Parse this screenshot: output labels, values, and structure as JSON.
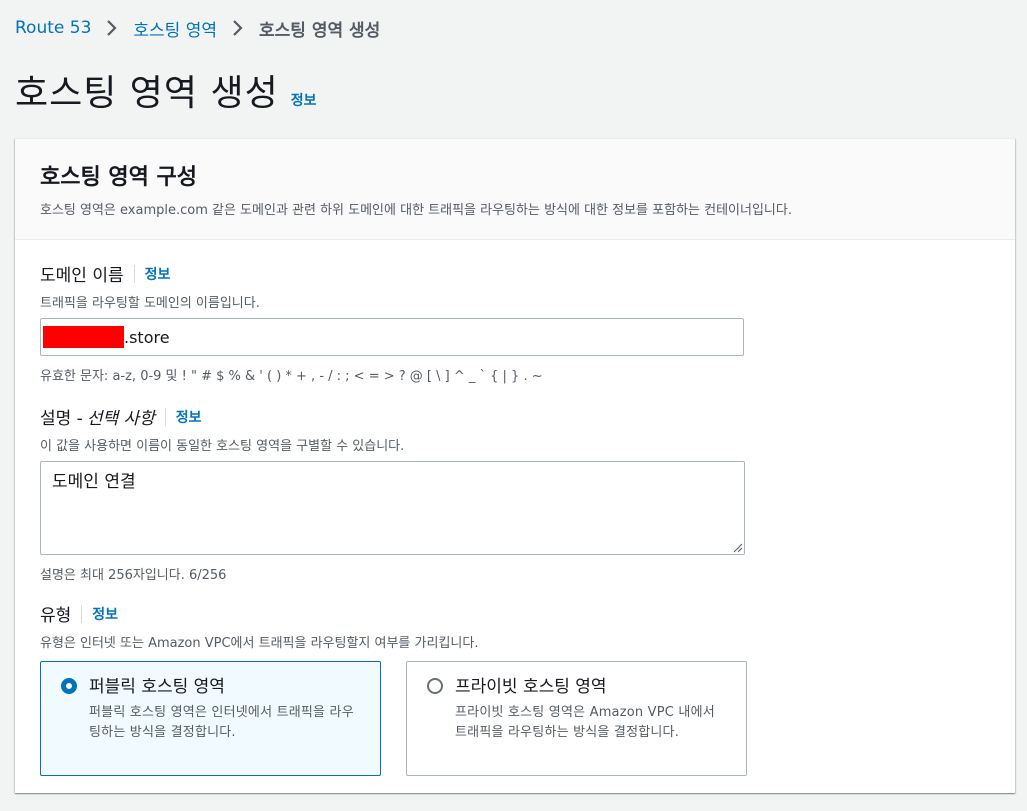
{
  "breadcrumb": {
    "items": [
      "Route 53",
      "호스팅 영역"
    ],
    "current": "호스팅 영역 생성"
  },
  "page": {
    "title": "호스팅 영역 생성",
    "info": "정보"
  },
  "card": {
    "title": "호스팅 영역 구성",
    "description": "호스팅 영역은 example.com 같은 도메인과 관련 하위 도메인에 대한 트래픽을 라우팅하는 방식에 대한 정보를 포함하는 컨테이너입니다."
  },
  "domain_field": {
    "label": "도메인 이름",
    "info": "정보",
    "description": "트래픽을 라우팅할 도메인의 이름입니다.",
    "value_suffix": ".store",
    "constraint": "유효한 문자: a-z, 0-9 및 ! \" # $ % & ' ( ) * + , - / : ; < = > ? @ [ \\ ] ^ _ ` { | } . ~"
  },
  "description_field": {
    "label": "설명 - ",
    "label_optional": "선택 사항",
    "info": "정보",
    "description": "이 값을 사용하면 이름이 동일한 호스팅 영역을 구별할 수 있습니다.",
    "value": "도메인 연결",
    "constraint": "설명은 최대 256자입니다. 6/256"
  },
  "type_field": {
    "label": "유형",
    "info": "정보",
    "description": "유형은 인터넷 또는 Amazon VPC에서 트래픽을 라우팅할지 여부를 가리킵니다.",
    "options": [
      {
        "title": "퍼블릭 호스팅 영역",
        "description": "퍼블릭 호스팅 영역은 인터넷에서 트래픽을 라우팅하는 방식을 결정합니다.",
        "selected": true
      },
      {
        "title": "프라이빗 호스팅 영역",
        "description": "프라이빗 호스팅 영역은 Amazon VPC 내에서 트래픽을 라우팅하는 방식을 결정합니다.",
        "selected": false
      }
    ]
  },
  "colors": {
    "link": "#0073bb",
    "selected_tile_bg": "#f1faff",
    "redaction": "#ff0000"
  }
}
